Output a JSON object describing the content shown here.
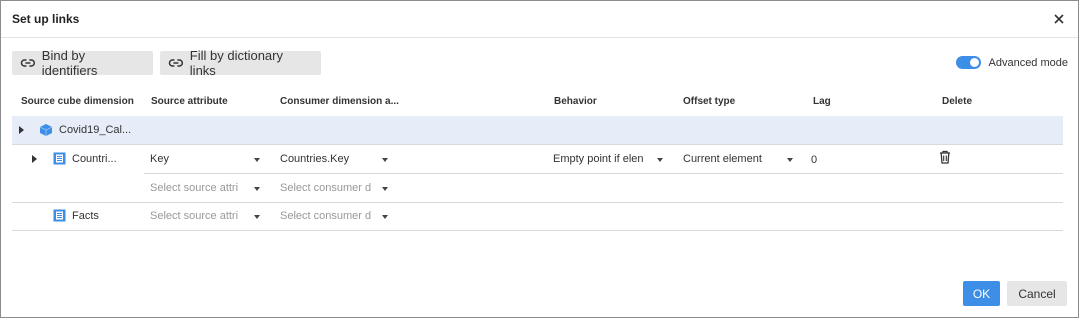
{
  "dialog": {
    "title": "Set up links",
    "close_icon": "close-icon"
  },
  "toolbar": {
    "bind_label": "Bind by identifiers",
    "fill_label": "Fill by dictionary links",
    "advanced_label": "Advanced mode",
    "advanced_on": true
  },
  "table": {
    "headers": [
      "Source cube dimension",
      "Source attribute",
      "Consumer dimension a...",
      "Behavior",
      "Offset type",
      "Lag",
      "Delete"
    ],
    "cube_row": {
      "name": "Covid19_Cal..."
    },
    "dim_row": {
      "name": "Countri...",
      "source_attr": "Key",
      "consumer_attr": "Countries.Key",
      "behavior": "Empty point if elen",
      "offset_type": "Current element",
      "lag": "0"
    },
    "empty_row": {
      "source_placeholder": "Select source attri",
      "consumer_placeholder": "Select consumer d"
    },
    "facts_row": {
      "name": "Facts",
      "source_placeholder": "Select source attri",
      "consumer_placeholder": "Select consumer d"
    }
  },
  "footer": {
    "ok_label": "OK",
    "cancel_label": "Cancel"
  },
  "colors": {
    "accent": "#3d8ee6",
    "selected_row": "#e6ecf8",
    "cube_icon": "#3d8ee6"
  }
}
